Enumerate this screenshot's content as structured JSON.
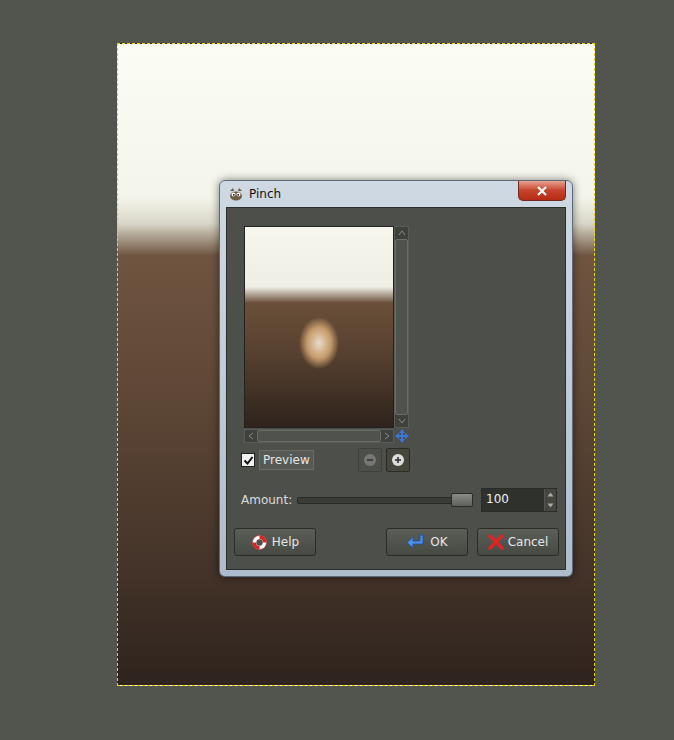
{
  "window": {
    "title": "Pinch"
  },
  "preview": {
    "label": "Preview",
    "checked": true
  },
  "zoom": [
    {
      "name": "zoom-out",
      "disabled": true
    },
    {
      "name": "zoom-in",
      "disabled": false
    }
  ],
  "amount": {
    "label": "Amount:",
    "value": "100",
    "level": 1.0
  },
  "buttons": [
    {
      "label": "Help",
      "kind": "help"
    },
    {
      "label": "OK",
      "kind": "ok"
    },
    {
      "label": "Cancel",
      "kind": "cancel"
    }
  ]
}
